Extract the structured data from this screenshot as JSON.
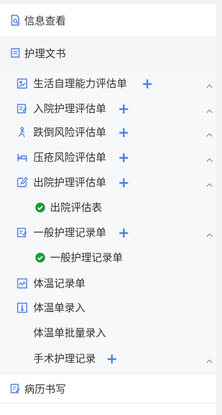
{
  "colors": {
    "accent": "#4a7be0",
    "success": "#1a9b3c",
    "text": "#333333"
  },
  "info_section": {
    "label": "信息查看",
    "icon": "document-search-icon"
  },
  "care_section": {
    "label": "护理文书",
    "icon": "notebook-icon"
  },
  "history_section": {
    "label": "病历书写",
    "icon": "document-edit-icon"
  },
  "items": [
    {
      "label": "生活自理能力评估单",
      "icon": "self-care-icon",
      "add": true,
      "collapse": true
    },
    {
      "label": "入院护理评估单",
      "icon": "edit-form-icon",
      "add": true,
      "collapse": true
    },
    {
      "label": "跌倒风险评估单",
      "icon": "fall-person-icon",
      "add": true,
      "collapse": true
    },
    {
      "label": "压疮风险评估单",
      "icon": "bed-icon",
      "add": true,
      "collapse": true
    },
    {
      "label": "出院护理评估单",
      "icon": "pencil-edit-icon",
      "add": true,
      "collapse": true
    },
    {
      "label": "出院评估表",
      "icon": "check-circle-icon",
      "sub": true
    },
    {
      "label": "一般护理记录单",
      "icon": "edit-form-icon",
      "add": true,
      "collapse": true
    },
    {
      "label": "一般护理记录单",
      "icon": "check-circle-icon",
      "sub": true
    },
    {
      "label": "体温记录单",
      "icon": "chart-line-icon"
    },
    {
      "label": "体温单录入",
      "icon": "thermometer-icon"
    },
    {
      "label": "体温单批量录入",
      "icon": ""
    },
    {
      "label": "手术护理记录",
      "icon": "",
      "add": true,
      "collapse": true
    }
  ],
  "plus_symbol": "+"
}
